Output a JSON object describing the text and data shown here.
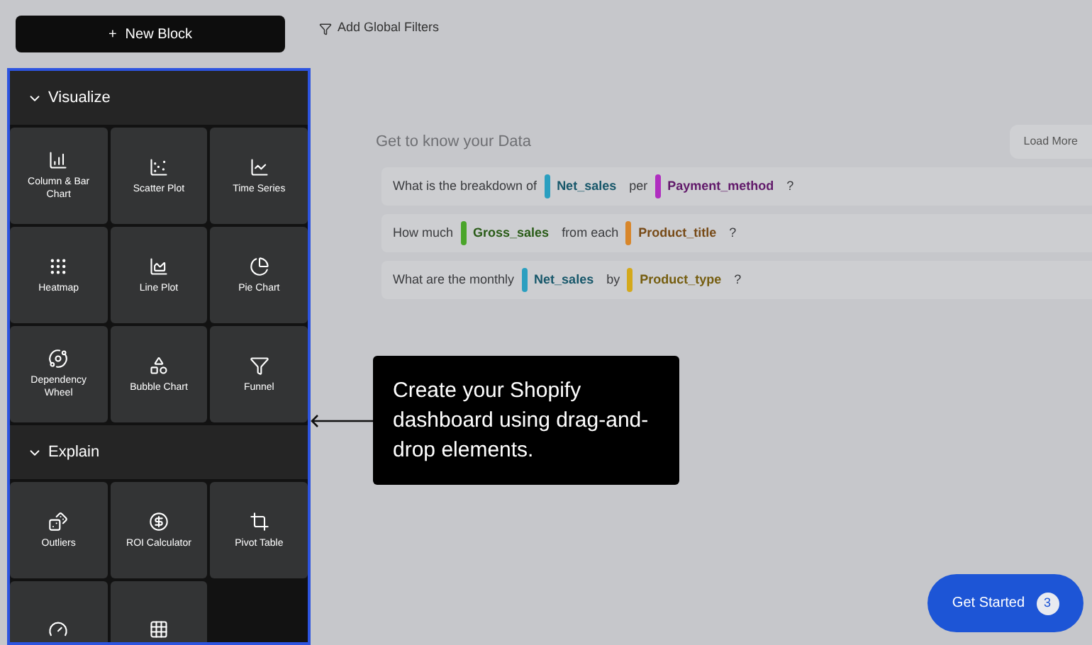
{
  "toolbar": {
    "new_block": {
      "icon": "+",
      "label": "New Block"
    },
    "filters": {
      "label": "Add Global Filters"
    }
  },
  "panel": {
    "sections": [
      {
        "title": "Visualize",
        "expanded": true,
        "items": [
          {
            "kind": "labeled",
            "label": "Column & Bar Chart"
          },
          {
            "kind": "labeled",
            "label": "Scatter Plot"
          },
          {
            "kind": "labeled",
            "label": "Time Series"
          },
          {
            "kind": "labeled",
            "label": "Heatmap"
          },
          {
            "kind": "labeled",
            "label": "Line Plot"
          },
          {
            "kind": "labeled",
            "label": "Pie Chart"
          },
          {
            "kind": "labeled",
            "label": "Dependency Wheel"
          },
          {
            "kind": "labeled",
            "label": "Bubble Chart"
          },
          {
            "kind": "labeled",
            "label": "Funnel"
          }
        ]
      },
      {
        "title": "Explain",
        "expanded": true,
        "items": [
          {
            "kind": "labeled",
            "label": "Outliers"
          },
          {
            "kind": "labeled",
            "label": "ROI Calculator"
          },
          {
            "kind": "labeled",
            "label": "Pivot Table"
          },
          {
            "kind": "unlabeled"
          },
          {
            "kind": "unlabeled"
          }
        ]
      }
    ]
  },
  "insights": {
    "title": "Get to know your Data",
    "load_more": "Load More",
    "questions": [
      [
        {
          "kind": "text",
          "text": "What is the breakdown of"
        },
        {
          "kind": "token",
          "text": "Net_sales",
          "color": "#2a9fc0"
        },
        {
          "kind": "text",
          "text": "per"
        },
        {
          "kind": "token",
          "text": "Payment_method",
          "color": "#b02ec0"
        },
        {
          "kind": "text",
          "text": "?"
        }
      ],
      [
        {
          "kind": "text",
          "text": "How much"
        },
        {
          "kind": "token",
          "text": "Gross_sales",
          "color": "#4aa52a"
        },
        {
          "kind": "text",
          "text": "from each"
        },
        {
          "kind": "token",
          "text": "Product_title",
          "color": "#d8862a"
        },
        {
          "kind": "text",
          "text": "?"
        }
      ],
      [
        {
          "kind": "text",
          "text": "What are the monthly"
        },
        {
          "kind": "token",
          "text": "Net_sales",
          "color": "#2a9fc0"
        },
        {
          "kind": "text",
          "text": "by"
        },
        {
          "kind": "token",
          "text": "Product_type",
          "color": "#d4a91c"
        },
        {
          "kind": "text",
          "text": "?"
        }
      ]
    ]
  },
  "tooltip": {
    "text": "Create your Shopify dashboard using drag-and-drop elements."
  },
  "get_started": {
    "label": "Get Started",
    "count": "3"
  }
}
